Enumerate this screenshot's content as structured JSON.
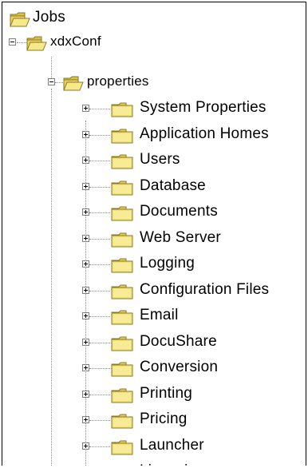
{
  "tree": {
    "root": {
      "label": "Jobs",
      "icon": "folder-open-icon"
    },
    "level1": {
      "label": "xdxConf",
      "icon": "folder-open-icon",
      "expanded": true
    },
    "level2": {
      "label": "properties",
      "icon": "folder-open-icon",
      "expanded": true
    },
    "items": [
      {
        "label": "System Properties",
        "icon": "folder-closed-icon"
      },
      {
        "label": "Application Homes",
        "icon": "folder-closed-icon"
      },
      {
        "label": "Users",
        "icon": "folder-closed-icon"
      },
      {
        "label": "Database",
        "icon": "folder-closed-icon"
      },
      {
        "label": "Documents",
        "icon": "folder-closed-icon"
      },
      {
        "label": "Web Server",
        "icon": "folder-closed-icon"
      },
      {
        "label": "Logging",
        "icon": "folder-closed-icon"
      },
      {
        "label": "Configuration Files",
        "icon": "folder-closed-icon"
      },
      {
        "label": "Email",
        "icon": "folder-closed-icon"
      },
      {
        "label": "DocuShare",
        "icon": "folder-closed-icon"
      },
      {
        "label": "Conversion",
        "icon": "folder-closed-icon"
      },
      {
        "label": "Printing",
        "icon": "folder-closed-icon"
      },
      {
        "label": "Pricing",
        "icon": "folder-closed-icon"
      },
      {
        "label": "Launcher",
        "icon": "folder-closed-icon"
      },
      {
        "label": "Licensing",
        "icon": "folder-closed-icon"
      }
    ]
  },
  "colors": {
    "folder_fill": "#f2e078",
    "folder_edge": "#8a7a2a",
    "folder_open_fill": "#e9d35a",
    "tree_lines": "#8c8c8c"
  }
}
